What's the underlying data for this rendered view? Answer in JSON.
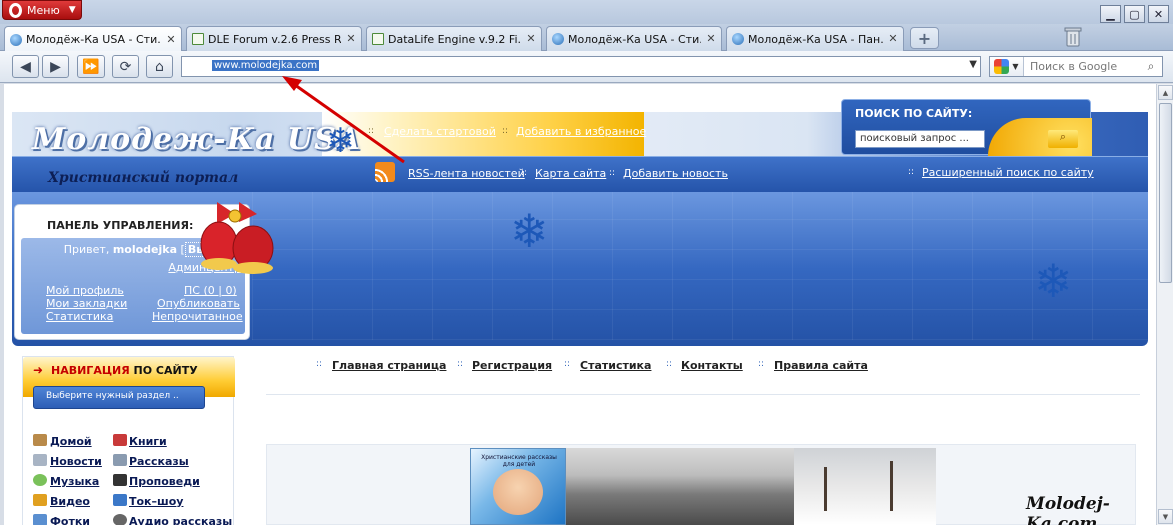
{
  "browser": {
    "menu_label": "Меню",
    "tabs": [
      {
        "title": "Молодёж-Ка USA - Сти...",
        "active": true
      },
      {
        "title": "DLE Forum v.2.6 Press R...",
        "active": false
      },
      {
        "title": "DataLife Engine v.9.2 Fi...",
        "active": false
      },
      {
        "title": "Молодёж-Ка USA - Сти...",
        "active": false
      },
      {
        "title": "Молодёж-Ка USA - Пан...",
        "active": false
      }
    ],
    "new_tab_label": "+",
    "address": "www.molodejka.com",
    "search_placeholder": "Поиск в Google"
  },
  "site": {
    "logo": "Молодеж-Ка USA",
    "slogan": "Христианский портал",
    "top_links": {
      "make_start": "Сделать стартовой",
      "add_fav": "Добавить в избранное"
    },
    "bar_links": {
      "rss": "RSS-лента новостей",
      "sitemap": "Карта сайта",
      "add_news": "Добавить новость"
    },
    "search": {
      "title": "ПОИСК ПО САЙТУ:",
      "input_value": "поисковый запрос ...",
      "advanced": "Расширенный поиск по сайту"
    },
    "panel": {
      "title": "ПАНЕЛЬ УПРАВЛЕНИЯ:",
      "greeting": "Привет,",
      "username": "molodejka",
      "exit": "Выход",
      "admin": "Админцентр",
      "profile": "Мой профиль",
      "pm": "ПС (0 | 0)",
      "bookmarks": "Мои закладки",
      "publish": "Опубликовать",
      "stats": "Статистика",
      "unread": "Непрочитанное"
    },
    "site_nav": [
      "Главная страница",
      "Регистрация",
      "Статистика",
      "Контакты",
      "Правила сайта"
    ],
    "navigation": {
      "title_red": "НАВИГАЦИЯ",
      "title_rest": " ПО САЙТУ",
      "select_placeholder": "Выберите нужный раздел ..",
      "links_left": [
        "Домой",
        "Новости",
        "Музыка",
        "Видео",
        "Фотки"
      ],
      "links_right": [
        "Книги",
        "Рассказы",
        "Проповеди",
        "Ток–шоу",
        "Аудио рассказы"
      ]
    },
    "thumb_caption": "Христианские рассказы для детей",
    "watermark": "Molodej-Ka.com"
  },
  "colors": {
    "accent_blue": "#2554aa",
    "accent_yellow": "#ffcc33",
    "arrow_red": "#d40000"
  }
}
